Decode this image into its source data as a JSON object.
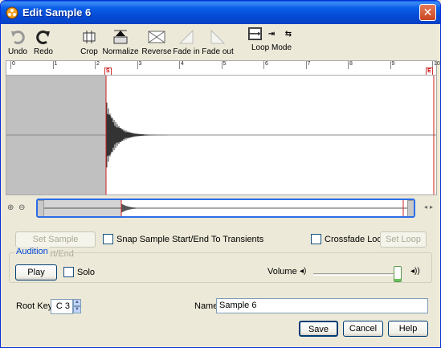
{
  "window": {
    "title": "Edit Sample 6",
    "close": "✕"
  },
  "toolbar": {
    "undo": "Undo",
    "redo": "Redo",
    "crop": "Crop",
    "normalize": "Normalize",
    "reverse": "Reverse",
    "fade_in": "Fade in",
    "fade_out": "Fade out",
    "loop_mode": "Loop Mode"
  },
  "ruler": {
    "ticks": [
      "0",
      "1",
      "2",
      "3",
      "4",
      "5",
      "6",
      "7",
      "8",
      "9",
      "10"
    ],
    "start_marker": "S",
    "end_marker": "E"
  },
  "controls": {
    "set_sample_start_end": "Set Sample Start/End",
    "snap_to_transients": "Snap Sample Start/End To Transients",
    "crossfade_loop": "Crossfade Loop",
    "set_loop": "Set Loop"
  },
  "audition": {
    "legend": "Audition",
    "play": "Play",
    "solo": "Solo",
    "volume_label": "Volume",
    "volume_level": 0.95
  },
  "footer": {
    "root_key_label": "Root Key:",
    "root_key_value": "C 3",
    "name_label": "Name:",
    "name_value": "Sample 6",
    "save": "Save",
    "cancel": "Cancel",
    "help": "Help"
  },
  "colors": {
    "accent": "#2b6de8",
    "marker": "#cc2222",
    "waveform": "#333333",
    "preroll": "#c0c0c0"
  }
}
